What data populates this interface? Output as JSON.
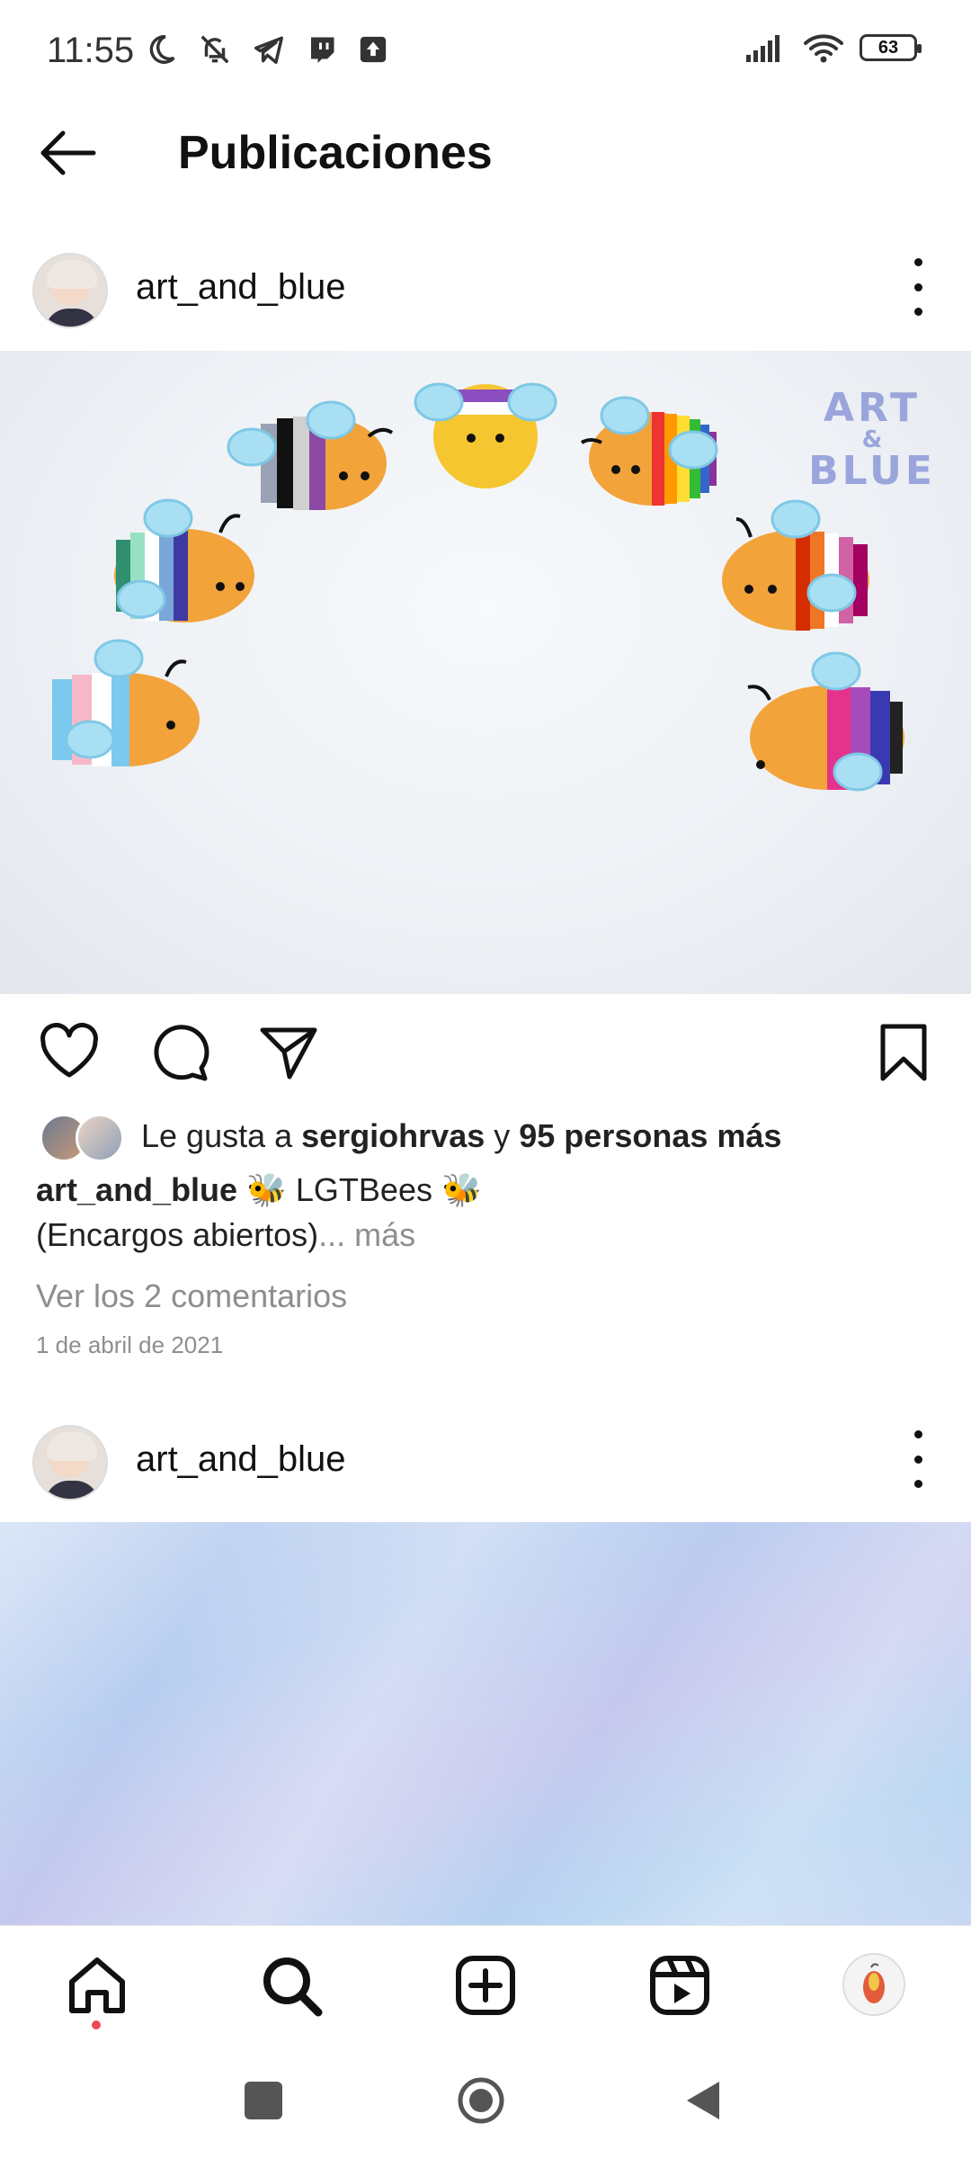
{
  "status_bar": {
    "time": "11:55",
    "battery": "63",
    "icons": [
      "moon-icon",
      "bell-off-icon",
      "telegram-icon",
      "twitch-icon",
      "upload-icon",
      "signal-icon",
      "wifi-icon",
      "battery-icon"
    ]
  },
  "header": {
    "title": "Publicaciones"
  },
  "post1": {
    "username": "art_and_blue",
    "image_alt": "crocheted bees",
    "watermark": {
      "line1": "ART",
      "line2": "&",
      "line3": "BLUE"
    },
    "likes": {
      "prefix": "Le gusta a ",
      "user": "sergiohrvas",
      "middle": " y ",
      "others": "95 personas más"
    },
    "caption": {
      "user": "art_and_blue",
      "text": " 🐝 LGTBees 🐝",
      "line2": "(Encargos abiertos)",
      "more": "... más"
    },
    "comments_link": "Ver los 2 comentarios",
    "date": "1 de abril de 2021"
  },
  "post2": {
    "username": "art_and_blue"
  },
  "colors": {
    "accent_red": "#ed4956",
    "muted": "#8e8e8e"
  },
  "bottom_nav": [
    "home-icon",
    "search-icon",
    "new-post-icon",
    "reels-icon",
    "profile-avatar"
  ],
  "system_nav": [
    "recents-button",
    "home-button",
    "back-button"
  ]
}
